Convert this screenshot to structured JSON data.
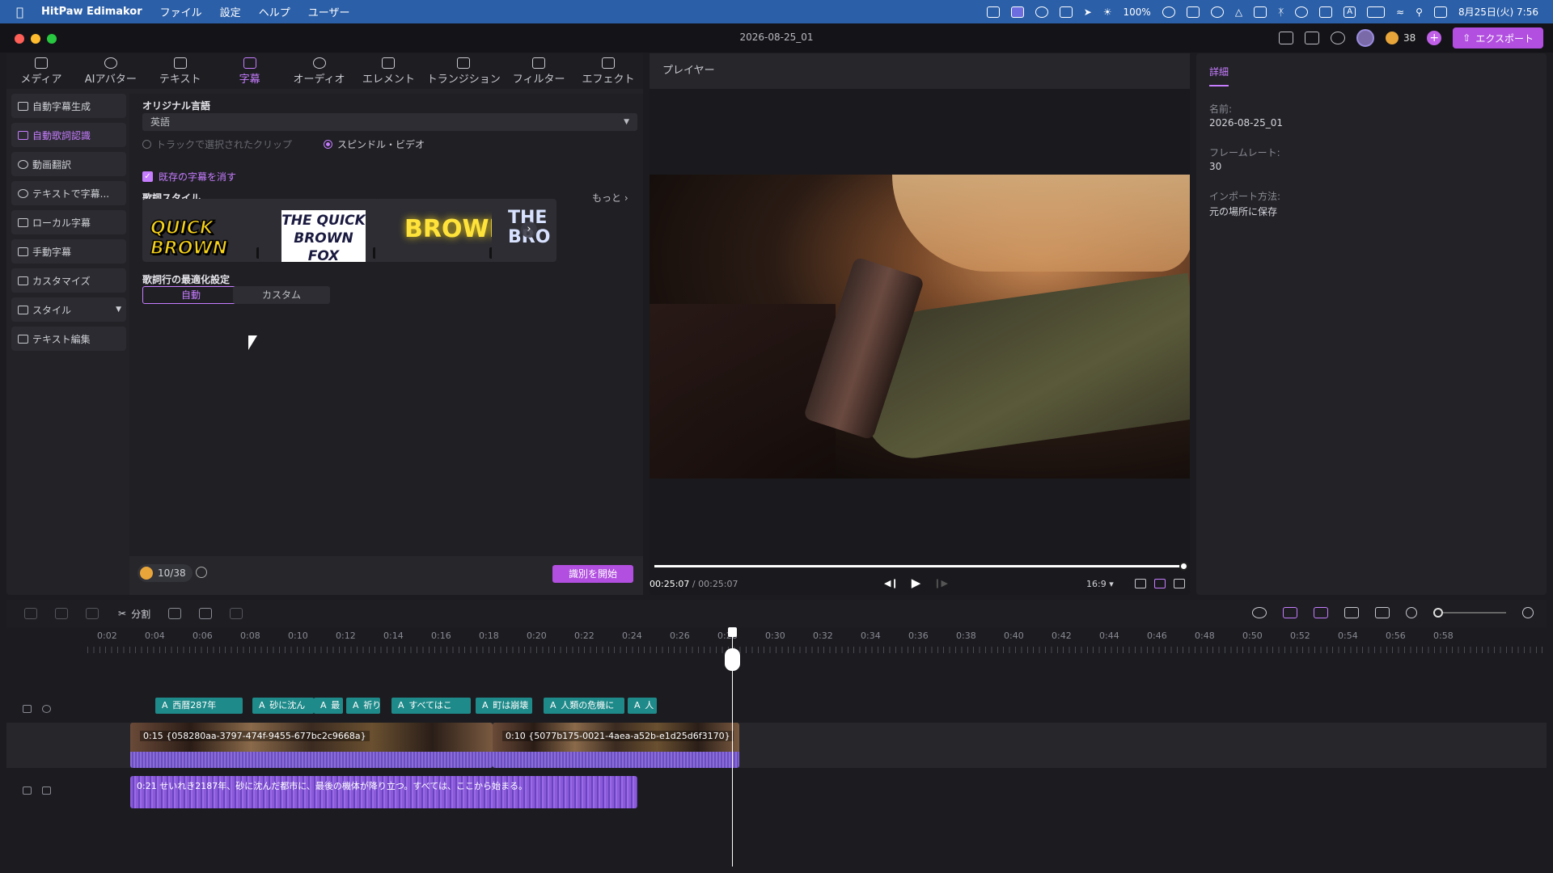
{
  "menubar": {
    "app": "HitPaw Edimakor",
    "items": [
      "ファイル",
      "設定",
      "ヘルプ",
      "ユーザー"
    ],
    "battery": "100%",
    "ime": "A",
    "datetime": "8月25日(火) 7:56"
  },
  "window": {
    "title": "2026-08-25_01",
    "credits": "38",
    "export_label": "エクスポート"
  },
  "toolbar": {
    "tabs": [
      "メディア",
      "AIアバター",
      "テキスト",
      "字幕",
      "オーディオ",
      "エレメント",
      "トランジション",
      "フィルター",
      "エフェクト"
    ],
    "active": "字幕"
  },
  "sidebar": {
    "items": [
      "自動字幕生成",
      "自動歌詞認識",
      "動画翻訳",
      "テキストで字幕...",
      "ローカル字幕",
      "手動字幕",
      "カスタマイズ",
      "スタイル",
      "テキスト編集"
    ],
    "active": "自動歌詞認識"
  },
  "panel": {
    "original_language_label": "オリジナル言語",
    "language_value": "英語",
    "radio_track": "トラックで選択されたクリップ",
    "radio_spindle": "スピンドル・ビデオ",
    "checkbox_label": "既存の字幕を消す",
    "lyric_style_label": "歌詞スタイル",
    "more_label": "もっと",
    "styles": [
      "QUICK BROWN",
      "THE QUICK BROWN FOX",
      "BROWN",
      "THE BRO"
    ],
    "opt_label": "歌詞行の最適化設定",
    "seg_auto": "自動",
    "seg_custom": "カスタム",
    "credit": "10/38",
    "start_button": "識別を開始"
  },
  "player": {
    "title": "プレイヤー",
    "current": "00:25:07",
    "total": "00:25:07",
    "ratio": "16:9",
    "progress": 1.0
  },
  "details": {
    "tab": "詳細",
    "name_label": "名前:",
    "name": "2026-08-25_01",
    "fps_label": "フレームレート:",
    "fps": "30",
    "import_label": "インポート方法:",
    "import": "元の場所に保存"
  },
  "timeline": {
    "split_label": "分割",
    "ticks": [
      "0:02",
      "0:04",
      "0:06",
      "0:08",
      "0:10",
      "0:12",
      "0:14",
      "0:16",
      "0:18",
      "0:20",
      "0:22",
      "0:24",
      "0:26",
      "0:28",
      "0:30",
      "0:32",
      "0:34",
      "0:36",
      "0:38",
      "0:40",
      "0:42",
      "0:44",
      "0:46",
      "0:48",
      "0:50",
      "0:52",
      "0:54",
      "0:56",
      "0:58"
    ],
    "lyrics": [
      "西暦287年",
      "砂に沈ん",
      "最",
      "祈り",
      "すべてはこ",
      "町は崩壊",
      "人類の危機に",
      "人"
    ],
    "clip1": "0:15 {058280aa-3797-474f-9455-677bc2c9668a}",
    "clip2": "0:10 {5077b175-0021-4aea-a52b-e1d25d6f3170}",
    "audio": "0:21 せいれき2187年、砂に沈んだ都市に、最後の機体が降り立つ。すべては、ここから始まる。"
  }
}
